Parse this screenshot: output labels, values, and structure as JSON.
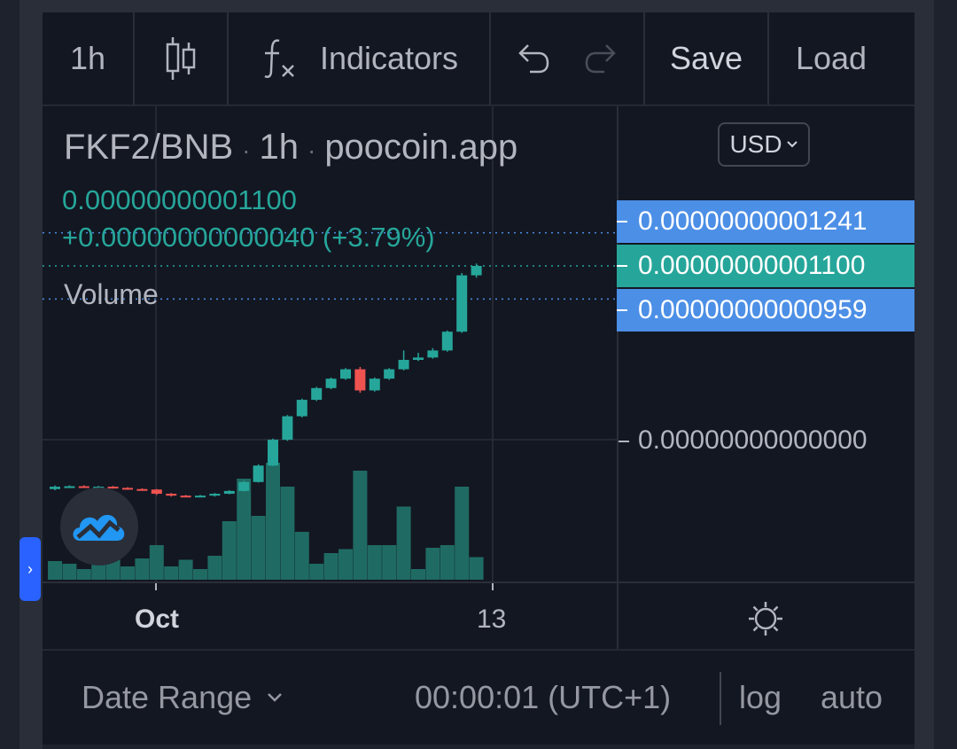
{
  "toolbar": {
    "interval": "1h",
    "indicators_label": "Indicators",
    "save_label": "Save",
    "load_label": "Load",
    "icons": [
      "candles-icon",
      "function-icon",
      "undo-icon",
      "redo-icon"
    ]
  },
  "legend": {
    "symbol": "FKF2/BNB",
    "interval": "1h",
    "source": "poocoin.app",
    "separator": "·",
    "price": "0.00000000001100",
    "change": "+0.00000000000040 (+3.79%)",
    "volume_label": "Volume"
  },
  "price_scale": {
    "currency": "USD",
    "labels": [
      {
        "text": "0.00000000001241",
        "color": "#4c8fe6"
      },
      {
        "text": "0.00000000001100",
        "color": "#26a69a"
      },
      {
        "text": "0.00000000000959",
        "color": "#4c8fe6"
      }
    ],
    "zero_label": "0.00000000000000"
  },
  "time_axis": {
    "labels": [
      "Oct",
      "13"
    ],
    "settings_icon": "gear-icon"
  },
  "bottom_bar": {
    "date_range_label": "Date Range",
    "timezone": "00:00:01 (UTC+1)",
    "log_label": "log",
    "auto_label": "auto"
  },
  "chart_data": {
    "type": "candlestick",
    "colors": {
      "up": "#26a69a",
      "down": "#ef5350",
      "background": "#131722",
      "grid": "#2a2e39"
    },
    "candles": [
      {
        "o": 1.5,
        "c": 1.6,
        "h": 1.65,
        "l": 1.45,
        "v": 14
      },
      {
        "o": 1.6,
        "c": 1.62,
        "h": 1.66,
        "l": 1.55,
        "v": 12
      },
      {
        "o": 1.62,
        "c": 1.58,
        "h": 1.66,
        "l": 1.55,
        "v": 8
      },
      {
        "o": 1.58,
        "c": 1.6,
        "h": 1.63,
        "l": 1.55,
        "v": 12
      },
      {
        "o": 1.6,
        "c": 1.55,
        "h": 1.63,
        "l": 1.52,
        "v": 17
      },
      {
        "o": 1.55,
        "c": 1.5,
        "h": 1.58,
        "l": 1.47,
        "v": 10
      },
      {
        "o": 1.5,
        "c": 1.48,
        "h": 1.53,
        "l": 1.45,
        "v": 16
      },
      {
        "o": 1.48,
        "c": 1.3,
        "h": 1.5,
        "l": 1.25,
        "v": 26
      },
      {
        "o": 1.3,
        "c": 1.22,
        "h": 1.33,
        "l": 1.18,
        "v": 10
      },
      {
        "o": 1.22,
        "c": 1.18,
        "h": 1.25,
        "l": 1.15,
        "v": 15
      },
      {
        "o": 1.18,
        "c": 1.22,
        "h": 1.25,
        "l": 1.15,
        "v": 8
      },
      {
        "o": 1.22,
        "c": 1.3,
        "h": 1.33,
        "l": 1.18,
        "v": 18
      },
      {
        "o": 1.3,
        "c": 1.42,
        "h": 1.45,
        "l": 1.28,
        "v": 44
      },
      {
        "o": 1.42,
        "c": 1.8,
        "h": 1.85,
        "l": 1.4,
        "v": 76
      },
      {
        "o": 1.8,
        "c": 2.5,
        "h": 2.55,
        "l": 1.78,
        "v": 48
      },
      {
        "o": 2.5,
        "c": 3.6,
        "h": 3.65,
        "l": 2.48,
        "v": 88
      },
      {
        "o": 3.6,
        "c": 4.6,
        "h": 4.65,
        "l": 3.55,
        "v": 70
      },
      {
        "o": 4.6,
        "c": 5.3,
        "h": 5.35,
        "l": 4.55,
        "v": 36
      },
      {
        "o": 5.3,
        "c": 5.8,
        "h": 5.85,
        "l": 5.25,
        "v": 12
      },
      {
        "o": 5.8,
        "c": 6.2,
        "h": 6.25,
        "l": 5.75,
        "v": 20
      },
      {
        "o": 6.2,
        "c": 6.6,
        "h": 6.65,
        "l": 6.15,
        "v": 23
      },
      {
        "o": 6.6,
        "c": 5.7,
        "h": 6.7,
        "l": 5.6,
        "v": 82
      },
      {
        "o": 5.7,
        "c": 6.2,
        "h": 6.25,
        "l": 5.65,
        "v": 26
      },
      {
        "o": 6.2,
        "c": 6.6,
        "h": 6.65,
        "l": 6.15,
        "v": 26
      },
      {
        "o": 6.6,
        "c": 7.0,
        "h": 7.4,
        "l": 6.55,
        "v": 55
      },
      {
        "o": 7.0,
        "c": 7.1,
        "h": 7.3,
        "l": 6.95,
        "v": 8
      },
      {
        "o": 7.1,
        "c": 7.4,
        "h": 7.5,
        "l": 7.05,
        "v": 24
      },
      {
        "o": 7.4,
        "c": 8.2,
        "h": 8.25,
        "l": 7.35,
        "v": 26
      },
      {
        "o": 8.2,
        "c": 10.6,
        "h": 10.7,
        "l": 8.15,
        "v": 70
      },
      {
        "o": 10.6,
        "c": 11.0,
        "h": 11.1,
        "l": 10.5,
        "v": 17
      }
    ],
    "price_lines": [
      12.41,
      11.0,
      9.59
    ],
    "y_unit": "1e-12"
  }
}
